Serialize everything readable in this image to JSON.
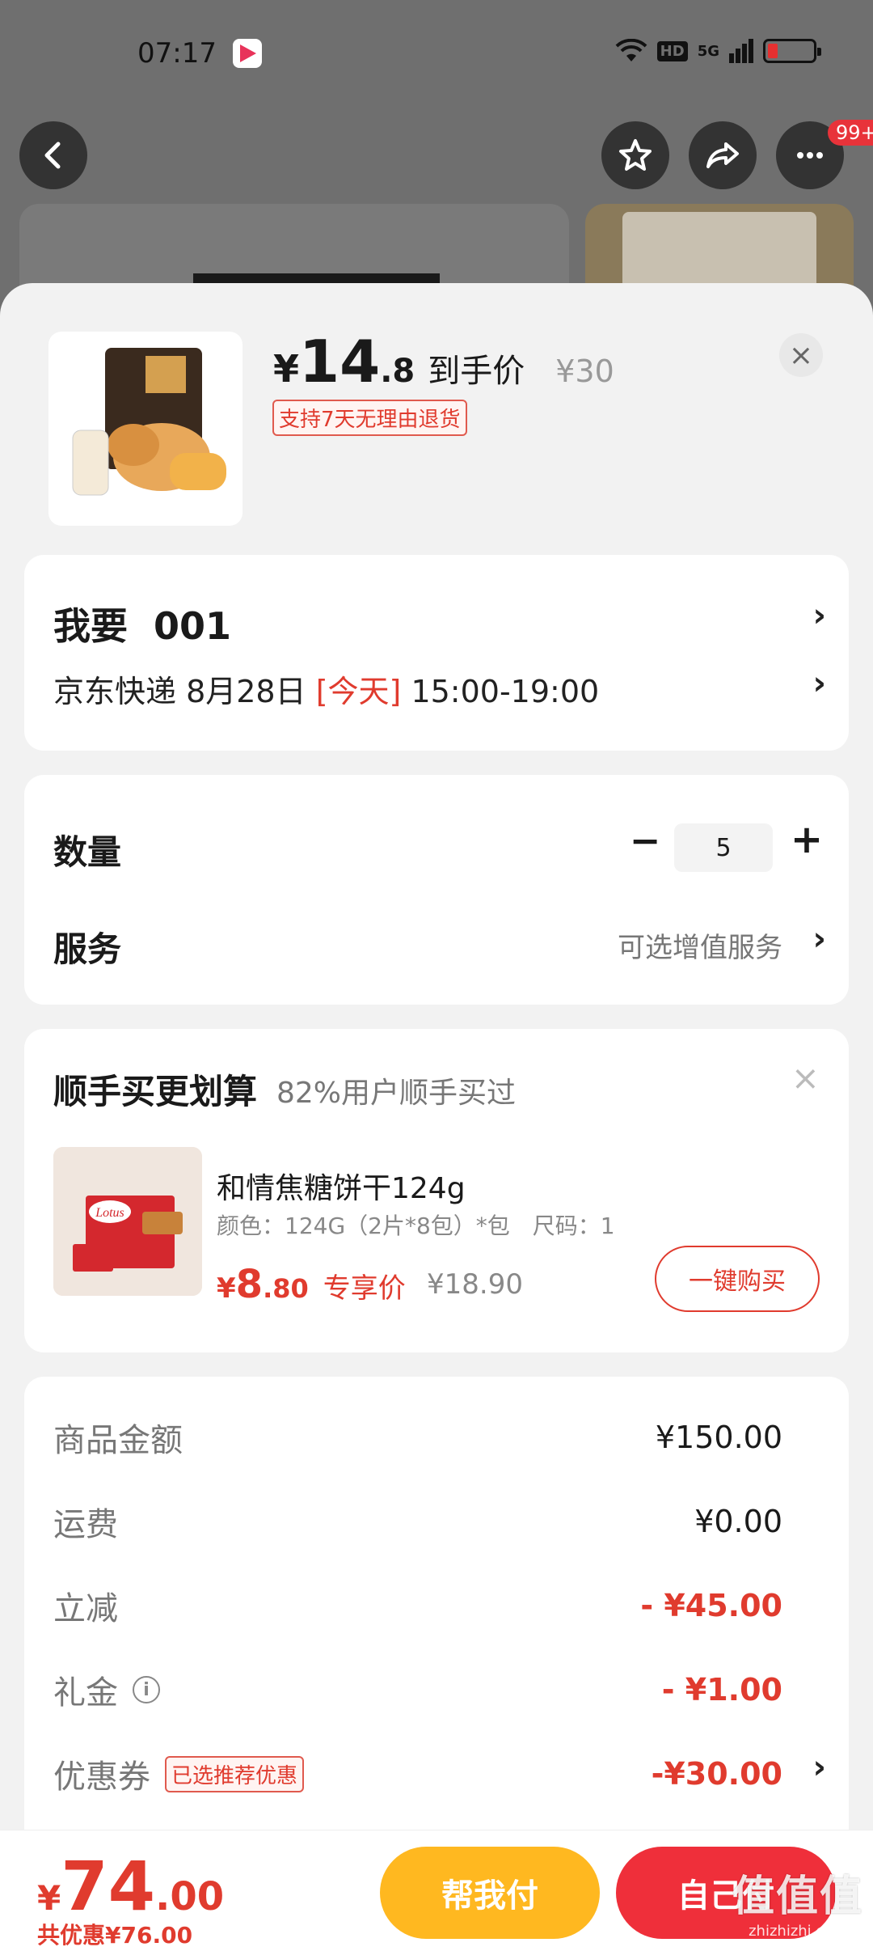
{
  "status_bar": {
    "time": "07:17",
    "hd": "HD",
    "signal": "5G"
  },
  "nav": {
    "badge": "99+"
  },
  "product": {
    "yen": "¥",
    "price_int": "14",
    "price_dec": ".8",
    "price_label": "到手价",
    "original_price": "¥30",
    "return_tag": "支持7天无理由退货",
    "close": "×"
  },
  "selection": {
    "want_prefix": "我要",
    "want_value": "001",
    "delivery_carrier": "京东快递 8月28日 ",
    "delivery_today": "[今天]",
    "delivery_time": " 15:00-19:00"
  },
  "quantity": {
    "label": "数量",
    "minus": "−",
    "value": "5",
    "plus": "+"
  },
  "service": {
    "label": "服务",
    "hint": "可选增值服务"
  },
  "combo": {
    "title": "顺手买更划算",
    "subtitle": "82%用户顺手买过",
    "close": "×",
    "item_name": "和情焦糖饼干124g",
    "item_spec": "颜色：124G（2片*8包）*包　尺码：1",
    "price_yen": "¥",
    "price_int": "8",
    "price_dec": ".80",
    "price_label": "专享价",
    "original_price": "¥18.90",
    "buy_button": "一键购买",
    "brand": "Lotus"
  },
  "summary": {
    "rows": [
      {
        "label": "商品金额",
        "value": "¥150.00"
      },
      {
        "label": "运费",
        "value": "¥0.00"
      },
      {
        "label": "立减",
        "value": "- ¥45.00"
      },
      {
        "label": "礼金",
        "value": "- ¥1.00"
      },
      {
        "label": "优惠券",
        "value": "-¥30.00",
        "tag": "已选推荐优惠"
      }
    ]
  },
  "bottom": {
    "total_yen": "¥",
    "total_int": "74",
    "total_dec": ".00",
    "saved": "共优惠¥76.00",
    "help_pay": "帮我付",
    "self_pay": "自己付"
  },
  "watermark": {
    "text": "值值值",
    "url": "zhizhizhi.com"
  },
  "colors": {
    "accent_red": "#e03b2e",
    "button_yellow": "#ffb820",
    "button_red": "#ef2f3a"
  }
}
